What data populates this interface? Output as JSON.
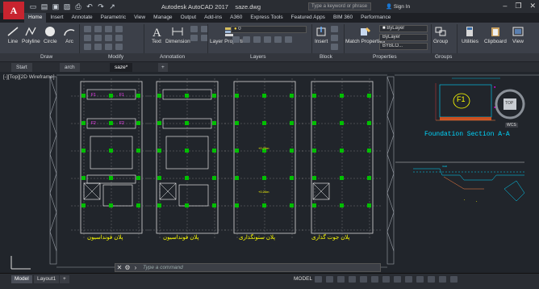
{
  "app": {
    "title": "Autodesk AutoCAD 2017",
    "filename": "saze.dwg",
    "search_placeholder": "Type a keyword or phrase",
    "signin": "Sign In"
  },
  "ribbon_tabs": [
    "Home",
    "Insert",
    "Annotate",
    "Parametric",
    "View",
    "Manage",
    "Output",
    "Add-ins",
    "A360",
    "Express Tools",
    "Featured Apps",
    "BIM 360",
    "Performance"
  ],
  "ribbon": {
    "draw_buttons": [
      "Line",
      "Polyline",
      "Circle",
      "Arc"
    ],
    "text_label": "Text",
    "dimension_label": "Dimension",
    "layer_properties_label": "Layer Properties",
    "insert_label": "Insert",
    "match_properties_label": "Match Properties",
    "group_label": "Group",
    "utilities_label": "Utilities",
    "clipboard_label": "Clipboard",
    "view_label": "View",
    "bylayer_1": "ByLayer",
    "bylayer_2": "ByLayer",
    "bylayer_3": "BYBLO...",
    "layer_value": "0"
  },
  "panel_labels": [
    "Draw",
    "Modify",
    "Annotation",
    "Layers",
    "Block",
    "Properties",
    "Groups"
  ],
  "file_tabs": [
    "Start",
    "arch",
    "saze*"
  ],
  "viewport_label": "[-][Top][2D Wireframe]",
  "drawing": {
    "plan_titles": [
      "پلان فونداسیون",
      "پلان فونداسیون",
      "پلان ستونگذاری",
      "پلان جوت گذاری"
    ],
    "foundation_section": "Foundation Section A-A",
    "footing_tag": "F1",
    "viewcube_label": "TOP",
    "wcs_label": "WCS"
  },
  "command_placeholder": "Type a command",
  "status": {
    "model_tab": "Model",
    "layout_tab": "Layout1",
    "model_button": "MODEL"
  },
  "colors": {
    "accent_red": "#c8242f",
    "cad_yellow": "#ffff00",
    "cad_green": "#00c000",
    "cad_cyan": "#00d8ff",
    "cad_magenta": "#ff00ff"
  }
}
